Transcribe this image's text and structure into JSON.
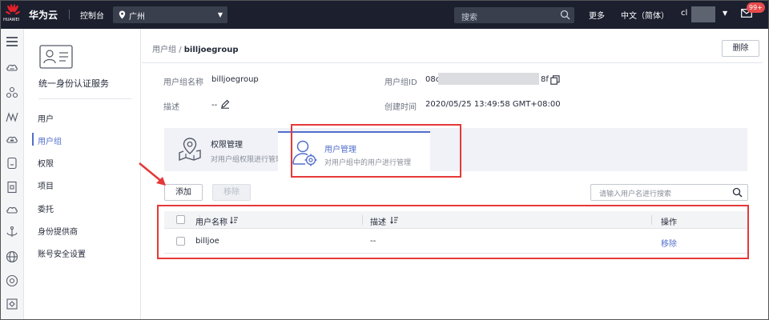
{
  "topbar": {
    "logo_text": "HUAWEI",
    "brand": "华为云",
    "console": "控制台",
    "region": "广州",
    "search_placeholder": "搜索",
    "more": "更多",
    "language": "中文（简体）",
    "user": "cl",
    "badge": "99+"
  },
  "rail": {
    "icons": [
      "menu-icon",
      "cloud-server-icon",
      "network-icon",
      "mountain-chart-icon",
      "storage-cloud-icon",
      "database-icon",
      "document-icon",
      "cloud-icon",
      "anchor-icon",
      "globe-icon",
      "settings-circle-icon",
      "scan-icon"
    ]
  },
  "sidebar": {
    "title": "统一身份认证服务",
    "items": [
      {
        "label": "用户",
        "active": false
      },
      {
        "label": "用户组",
        "active": true
      },
      {
        "label": "权限",
        "active": false
      },
      {
        "label": "项目",
        "active": false
      },
      {
        "label": "委托",
        "active": false
      },
      {
        "label": "身份提供商",
        "active": false
      },
      {
        "label": "账号安全设置",
        "active": false
      }
    ]
  },
  "breadcrumb": {
    "parent": "用户组",
    "separator": "/",
    "current": "billjoegroup"
  },
  "actions": {
    "delete": "删除"
  },
  "details": {
    "name_label": "用户组名称",
    "name_value": "billjoegroup",
    "id_label": "用户组ID",
    "id_prefix": "08c",
    "id_suffix": "8f",
    "desc_label": "描述",
    "desc_value": "--",
    "created_label": "创建时间",
    "created_value": "2020/05/25 13:49:58 GMT+08:00"
  },
  "tabs": [
    {
      "title": "权限管理",
      "subtitle": "对用户组权限进行管理",
      "active": false
    },
    {
      "title": "用户管理",
      "subtitle": "对用户组中的用户进行管理",
      "active": true
    }
  ],
  "toolbar": {
    "add": "添加",
    "remove": "移除",
    "search_placeholder": "请输入用户名进行搜索"
  },
  "table": {
    "headers": [
      "用户名称",
      "描述",
      "操作"
    ],
    "rows": [
      {
        "name": "billjoe",
        "description": "--",
        "action": "移除"
      }
    ]
  },
  "colors": {
    "topbar": "#1b1f2e",
    "accent": "#526ecc",
    "annotation": "#e53838",
    "badge": "#e64b4b"
  }
}
